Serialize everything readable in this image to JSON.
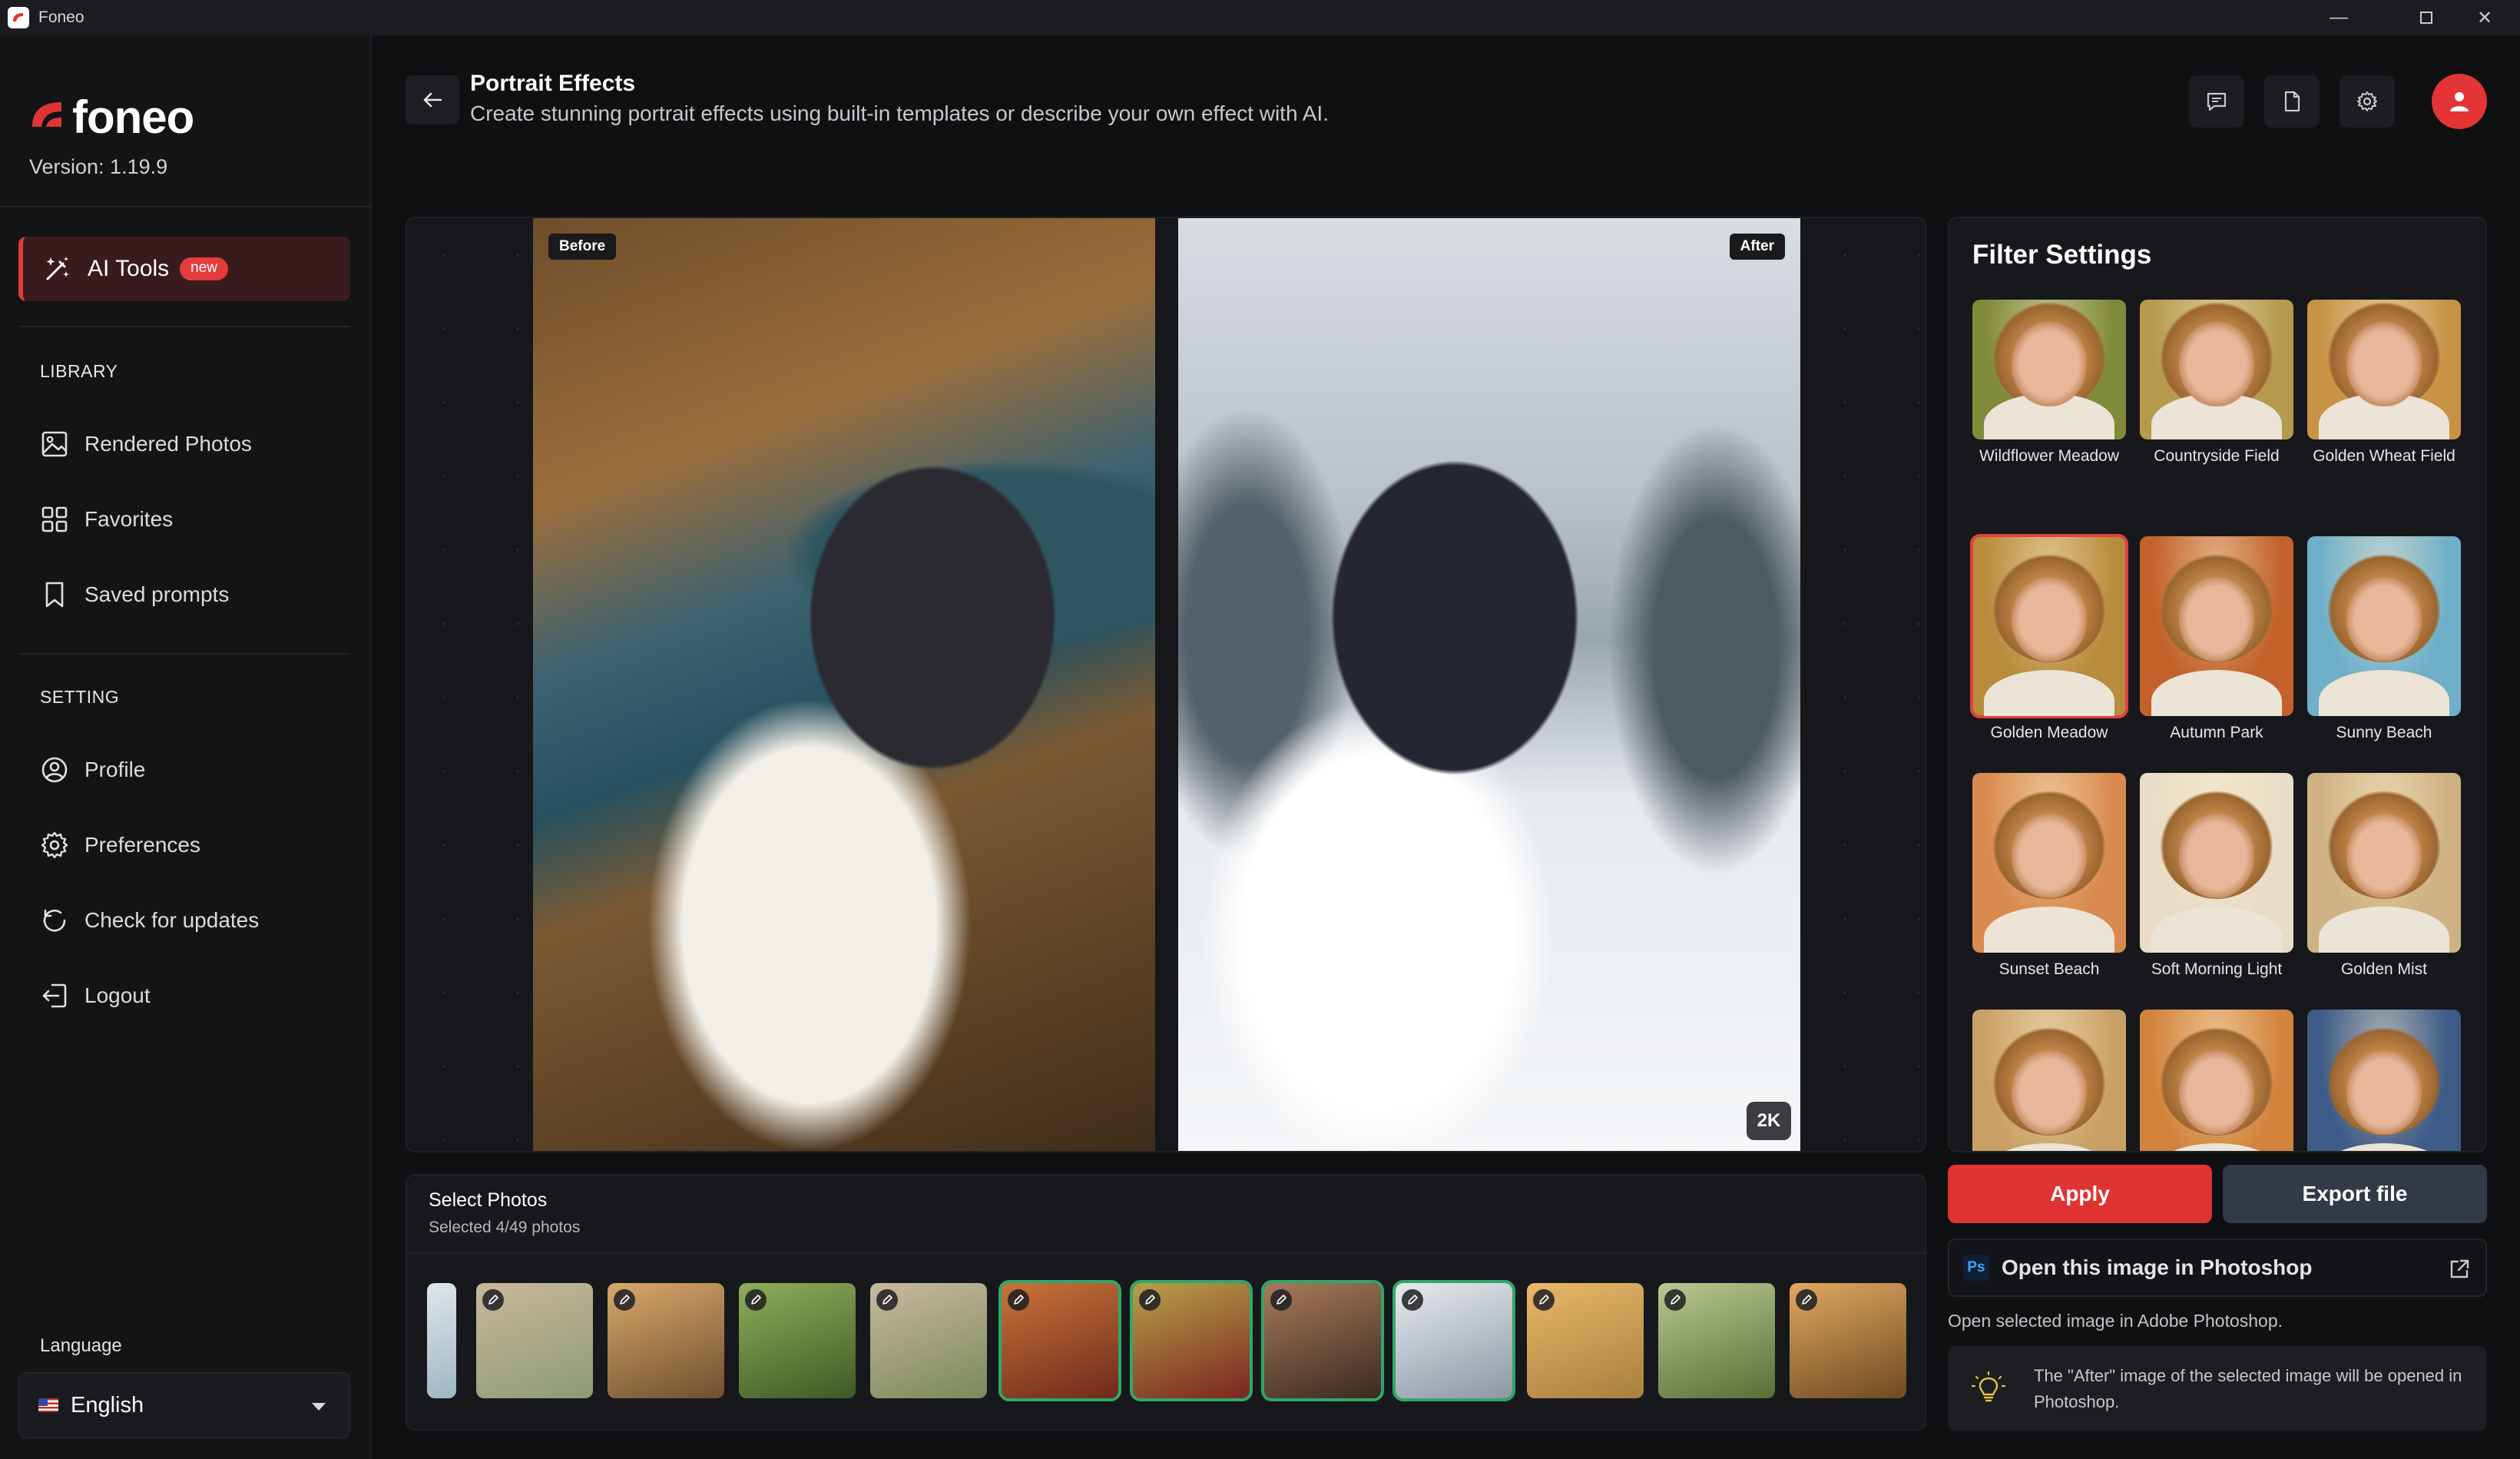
{
  "window": {
    "title": "Foneo"
  },
  "sidebar": {
    "logo_text": "foneo",
    "version": "Version: 1.19.9",
    "ai_tools": {
      "label": "AI Tools",
      "badge": "new"
    },
    "library_title": "LIBRARY",
    "library_items": [
      {
        "label": "Rendered Photos",
        "icon": "image-icon"
      },
      {
        "label": "Favorites",
        "icon": "grid-icon"
      },
      {
        "label": "Saved prompts",
        "icon": "bookmark-icon"
      }
    ],
    "setting_title": "SETTING",
    "setting_items": [
      {
        "label": "Profile",
        "icon": "user-circle-icon"
      },
      {
        "label": "Preferences",
        "icon": "gear-icon"
      },
      {
        "label": "Check for updates",
        "icon": "refresh-icon"
      },
      {
        "label": "Logout",
        "icon": "logout-icon"
      }
    ],
    "language_title": "Language",
    "language_value": "English"
  },
  "header": {
    "title": "Portrait Effects",
    "subtitle": "Create stunning portrait effects using built-in templates or describe your own effect with AI."
  },
  "preview": {
    "before_label": "Before",
    "after_label": "After",
    "resolution_badge": "2K"
  },
  "filters": {
    "title": "Filter Settings",
    "items": [
      {
        "label": "Wildflower Meadow",
        "bg": "#7f8a3a"
      },
      {
        "label": "Countryside Field",
        "bg": "#b59a4e"
      },
      {
        "label": "Golden Wheat Field",
        "bg": "#c79346"
      },
      {
        "label": "Golden Meadow",
        "bg": "#b88c3c",
        "selected": true
      },
      {
        "label": "Autumn Park",
        "bg": "#c2622a"
      },
      {
        "label": "Sunny Beach",
        "bg": "#6fb0c8"
      },
      {
        "label": "Sunset Beach",
        "bg": "#d98a4e"
      },
      {
        "label": "Soft Morning Light",
        "bg": "#e9dcc6"
      },
      {
        "label": "Golden Mist",
        "bg": "#cfb283"
      },
      {
        "label": "",
        "bg": "#c9a166"
      },
      {
        "label": "",
        "bg": "#d2843c"
      },
      {
        "label": "",
        "bg": "#3d5b86"
      }
    ]
  },
  "actions": {
    "apply": "Apply",
    "export": "Export file",
    "photoshop_logo": "Ps",
    "open_photoshop": "Open this image in Photoshop",
    "photoshop_help": "Open selected image in Adobe Photoshop.",
    "info_text": "The \"After\" image of the selected image will be opened in Photoshop."
  },
  "strip": {
    "title": "Select Photos",
    "subtitle": "Selected 4/49 photos",
    "thumbs": [
      {
        "bg": "linear-gradient(160deg,#c9b79a,#8c9b78)",
        "selected": false
      },
      {
        "bg": "linear-gradient(160deg,#d8a86a,#6e5030)",
        "selected": false
      },
      {
        "bg": "linear-gradient(160deg,#8fae5a,#3e5a26)",
        "selected": false
      },
      {
        "bg": "linear-gradient(160deg,#c8b8a0,#7a8a5a)",
        "selected": false
      },
      {
        "bg": "linear-gradient(160deg,#c8743a,#6e2a1c)",
        "selected": true
      },
      {
        "bg": "linear-gradient(160deg,#b8a04a,#7a2620)",
        "selected": true
      },
      {
        "bg": "linear-gradient(160deg,#a87a5a,#3a2a22)",
        "selected": true
      },
      {
        "bg": "linear-gradient(160deg,#e6eaee,#8c98a4)",
        "selected": true
      },
      {
        "bg": "linear-gradient(160deg,#e8b86a,#a8803e)",
        "selected": false
      },
      {
        "bg": "linear-gradient(160deg,#b8c890,#5a6e38)",
        "selected": false
      },
      {
        "bg": "linear-gradient(160deg,#e0a860,#6e4a22)",
        "selected": false
      }
    ]
  },
  "colors": {
    "accent": "#e03434",
    "selected_green": "#2fa86a"
  }
}
